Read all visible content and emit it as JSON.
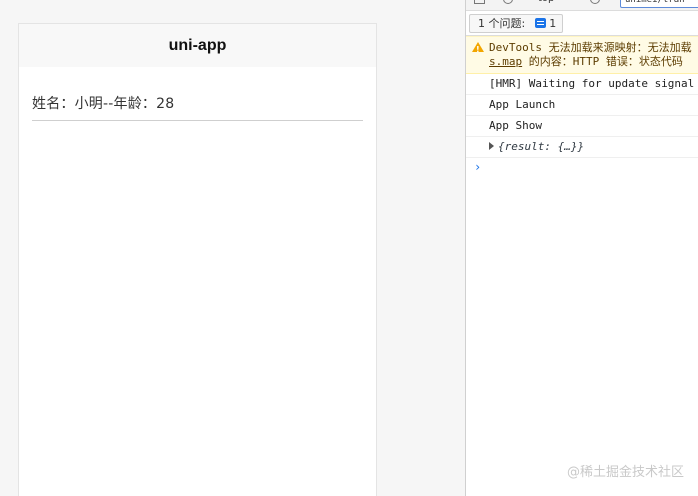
{
  "simulator": {
    "nav_title": "uni-app",
    "info_text": "姓名：小明--年龄：28"
  },
  "devtools": {
    "top_context": "top",
    "filter_value": "unimei/tran",
    "issues_label": "1 个问题:",
    "issues_count": "1",
    "warning": {
      "line1": "DevTools 无法加载来源映射：无法加载",
      "link": "s.map",
      "line2_rest": " 的内容：HTTP 错误：状态代码"
    },
    "logs": [
      "[HMR] Waiting for update signal",
      "App Launch",
      "App Show"
    ],
    "object_log": "{result: {…}}",
    "prompt": "›"
  },
  "watermark": "@稀土掘金技术社区",
  "colors": {
    "accent": "#1a73e8",
    "warning_bg": "#fffbe5",
    "warning_icon": "#f2a600"
  }
}
